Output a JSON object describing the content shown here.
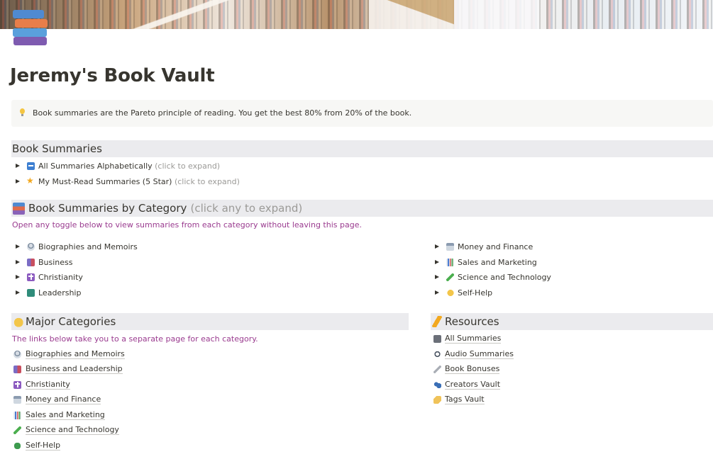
{
  "page": {
    "title": "Jeremy's Book Vault",
    "callout": "Book summaries are the Pareto principle of reading. You get the best 80% from 20% of the book.",
    "icon": "books-stack-icon"
  },
  "book_summaries": {
    "heading": "Book Summaries",
    "toggles": [
      {
        "icon": "abc-icon",
        "label": "All Summaries Alphabetically",
        "hint": "(click to expand)"
      },
      {
        "icon": "star-icon",
        "label": "My Must-Read Summaries (5 Star)",
        "hint": "(click to expand)"
      }
    ]
  },
  "by_category": {
    "heading": "Book Summaries by Category",
    "hint": "(click any to expand)",
    "note": "Open any toggle below to view summaries from each category without leaving this page.",
    "left": [
      {
        "icon": "bust-icon",
        "label": "Biographies and Memoirs"
      },
      {
        "icon": "briefcase-icon",
        "label": "Business"
      },
      {
        "icon": "cross-icon",
        "label": "Christianity"
      },
      {
        "icon": "leader-icon",
        "label": "Leadership"
      }
    ],
    "right": [
      {
        "icon": "bank-icon",
        "label": "Money and Finance"
      },
      {
        "icon": "chart-icon",
        "label": "Sales and Marketing"
      },
      {
        "icon": "test-tube-icon",
        "label": "Science and Technology"
      },
      {
        "icon": "flexed-arm-icon",
        "label": "Self-Help"
      }
    ]
  },
  "major": {
    "heading": "Major Categories",
    "note": "The links below take you to a separate page for each category.",
    "links": [
      {
        "icon": "bust-icon",
        "label": "Biographies and Memoirs"
      },
      {
        "icon": "briefcase-icon",
        "label": "Business and Leadership"
      },
      {
        "icon": "cross-icon",
        "label": "Christianity"
      },
      {
        "icon": "bank-icon",
        "label": "Money and Finance"
      },
      {
        "icon": "chart-icon",
        "label": "Sales and Marketing"
      },
      {
        "icon": "test-tube-icon",
        "label": "Science and Technology"
      },
      {
        "icon": "clover-icon",
        "label": "Self-Help"
      }
    ]
  },
  "resources": {
    "heading": "Resources",
    "links": [
      {
        "icon": "book-icon",
        "label": "All Summaries"
      },
      {
        "icon": "headphones-icon",
        "label": "Audio Summaries"
      },
      {
        "icon": "paperclip-icon",
        "label": "Book Bonuses"
      },
      {
        "icon": "people-icon",
        "label": "Creators Vault"
      },
      {
        "icon": "tag-icon",
        "label": "Tags Vault"
      }
    ]
  },
  "colors": {
    "heading_bg": "#ebebee",
    "callout_bg": "#f7f7f5",
    "note_purple": "#9a3b8f",
    "text": "#37352f",
    "hint": "#9b9a97"
  }
}
